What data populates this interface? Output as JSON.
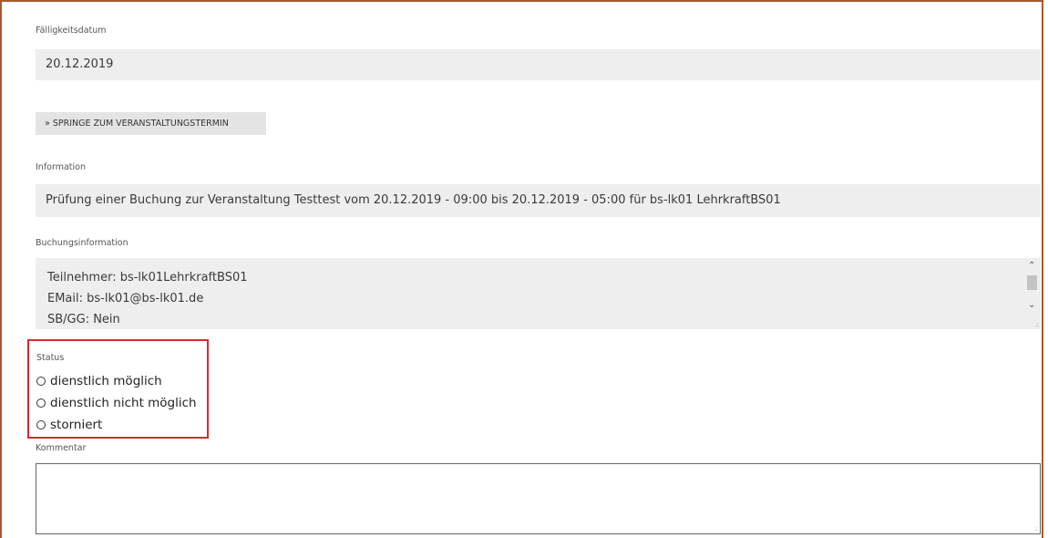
{
  "due_date": {
    "label": "Fälligkeitsdatum",
    "value": "20.12.2019"
  },
  "jump_button": {
    "label": "» SPRINGE ZUM VERANSTALTUNGSTERMIN"
  },
  "information": {
    "label": "Information",
    "value": "Prüfung einer Buchung zur Veranstaltung Testtest vom 20.12.2019 - 09:00 bis 20.12.2019 - 05:00 für bs-lk01 LehrkraftBS01"
  },
  "booking_info": {
    "label": "Buchungsinformation",
    "lines": [
      "Teilnehmer: bs-lk01LehrkraftBS01",
      "EMail: bs-lk01@bs-lk01.de",
      "SB/GG: Nein"
    ]
  },
  "status": {
    "label": "Status",
    "options": [
      "dienstlich möglich",
      "dienstlich nicht möglich",
      "storniert"
    ]
  },
  "comment": {
    "label": "Kommentar",
    "value": ""
  },
  "colors": {
    "frame": "#a85a2c",
    "highlight": "#e0262c",
    "field_bg": "#eeeeee"
  }
}
